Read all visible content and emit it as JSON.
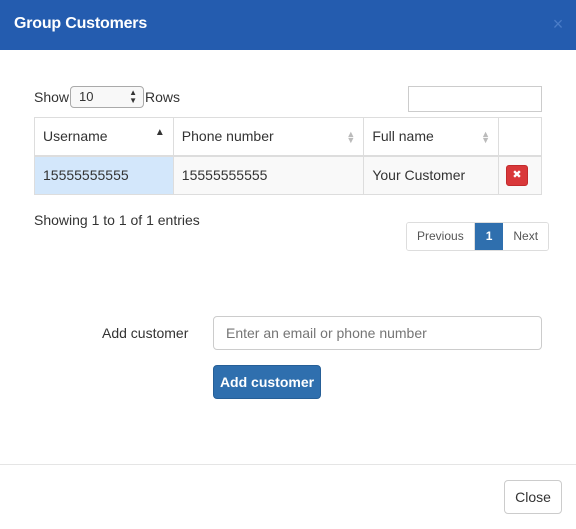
{
  "modal": {
    "title": "Group Customers",
    "close_icon": "×"
  },
  "table_controls": {
    "show_label": "Show",
    "rows_label": "Rows",
    "length_value": "10",
    "search_value": ""
  },
  "table": {
    "columns": [
      {
        "label": "Username",
        "sort": "asc"
      },
      {
        "label": "Phone number",
        "sort": "both"
      },
      {
        "label": "Full name",
        "sort": "both"
      },
      {
        "label": "",
        "sort": "none"
      }
    ],
    "rows": [
      {
        "username": "15555555555",
        "phone": "15555555555",
        "full_name": "Your Customer",
        "action_icon": "✖"
      }
    ]
  },
  "info": "Showing 1 to 1 of 1 entries",
  "pagination": {
    "previous": "Previous",
    "current": "1",
    "next": "Next"
  },
  "add_form": {
    "label": "Add customer",
    "input_value": "",
    "input_placeholder": "Enter an email or phone number",
    "button_label": "Add customer"
  },
  "footer": {
    "close_label": "Close"
  }
}
